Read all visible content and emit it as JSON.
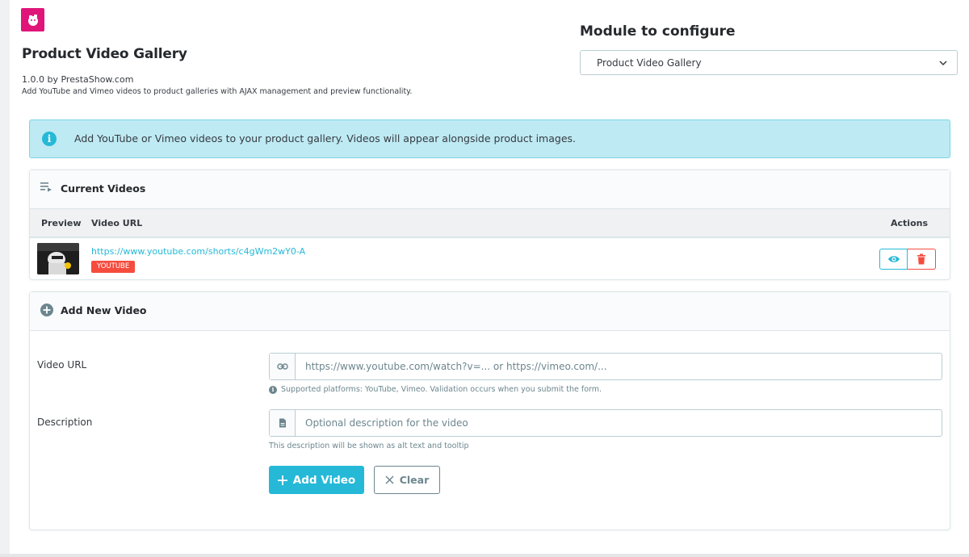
{
  "header": {
    "logo_icon": "puzzle-piggy-icon",
    "module_name": "Product Video Gallery",
    "version": "1.0.0 by PrestaShow.com",
    "description": "Add YouTube and Vimeo videos to product galleries with AJAX management and preview functionality."
  },
  "configure": {
    "label": "Module to configure",
    "selected": "Product Video Gallery"
  },
  "alert": {
    "text": "Add YouTube or Vimeo videos to your product gallery. Videos will appear alongside product images."
  },
  "current_videos": {
    "title": "Current Videos",
    "columns": {
      "preview": "Preview",
      "url": "Video URL",
      "actions": "Actions"
    },
    "rows": [
      {
        "url": "https://www.youtube.com/shorts/c4gWm2wY0-A",
        "platform": "YOUTUBE"
      }
    ]
  },
  "add_video": {
    "title": "Add New Video",
    "url_label": "Video URL",
    "url_placeholder": "https://www.youtube.com/watch?v=... or https://vimeo.com/...",
    "url_help": "Supported platforms: YouTube, Vimeo. Validation occurs when you submit the form.",
    "desc_label": "Description",
    "desc_placeholder": "Optional description for the video",
    "desc_help": "This description will be shown as alt text and tooltip",
    "add_button": "Add Video",
    "clear_button": "Clear"
  },
  "colors": {
    "primary": "#25b9d7",
    "danger": "#f54c3e",
    "logo": "#e0157a",
    "alert_bg": "#beeaf3"
  }
}
